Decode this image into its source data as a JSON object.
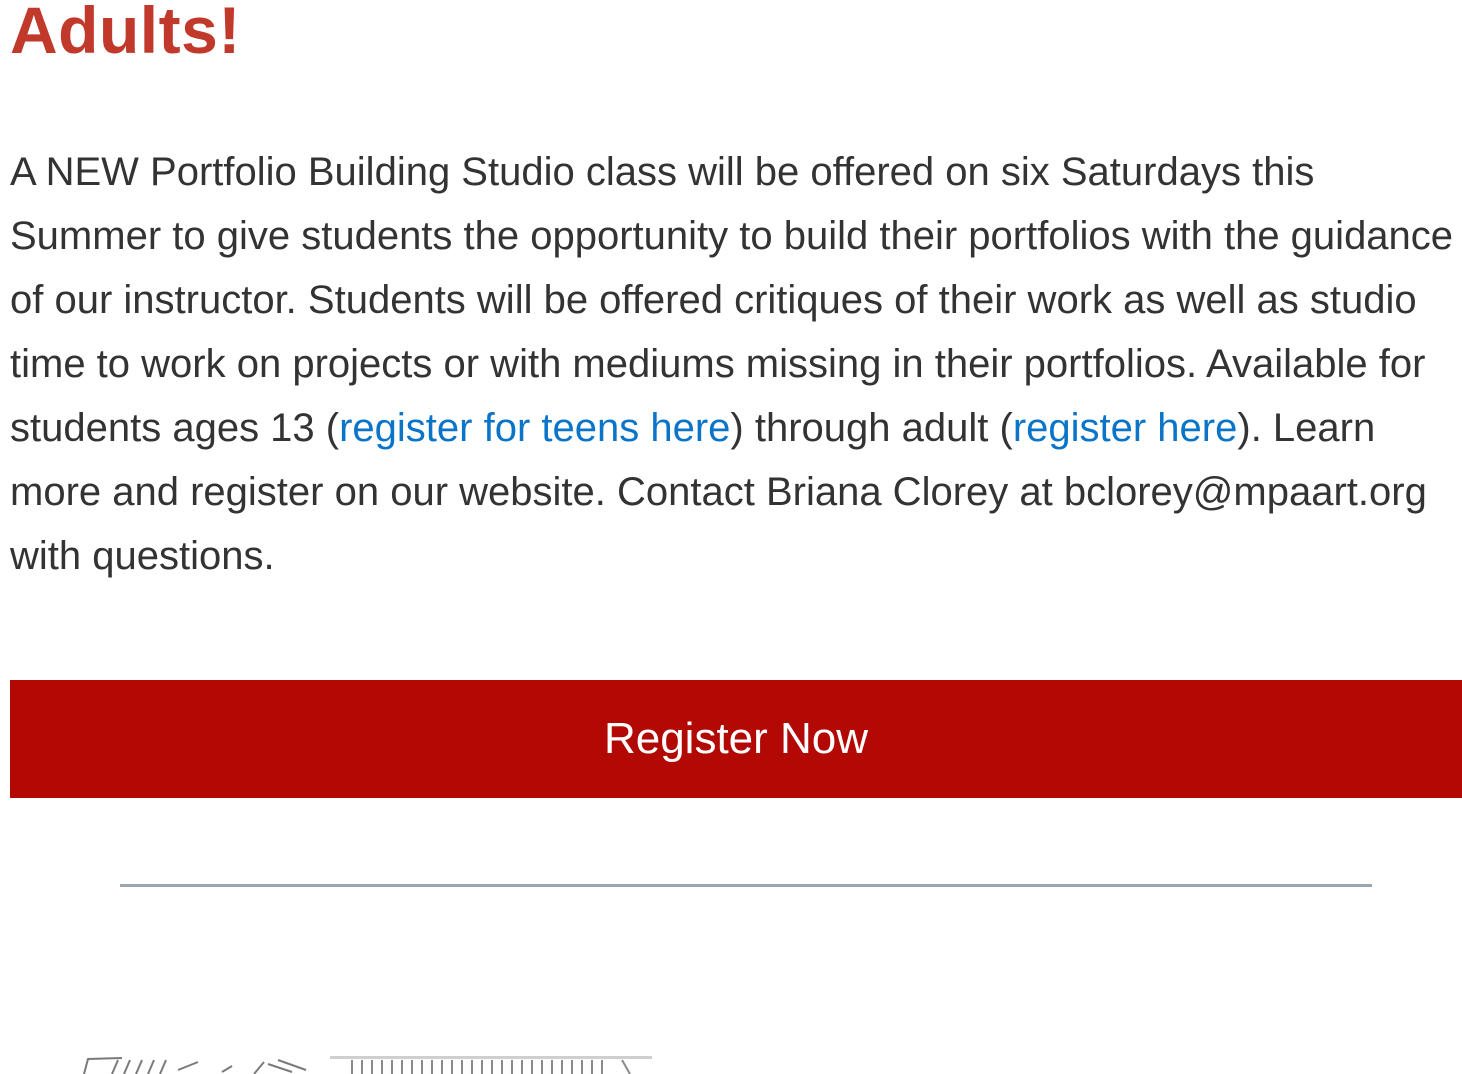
{
  "heading": "Adults!",
  "paragraph": {
    "part1": "A NEW Portfolio Building Studio class will be offered on six Saturdays this Summer to give students the opportunity to build their portfolios with the guidance of our instructor. Students will be offered critiques of their work as well as studio time to work on projects or with mediums missing in their portfolios. Available for students ages 13 (",
    "link_teens": "register for teens here",
    "part2": ") through adult (",
    "link_adult": "register here",
    "part3": "). Learn more and register on our website. Contact Briana Clorey at bclorey@mpaart.org with questions."
  },
  "register_button": "Register Now",
  "colors": {
    "heading": "#c0392b",
    "body_text": "#333333",
    "link": "#0a74c9",
    "button_bg": "#b30904",
    "button_text": "#ffffff",
    "divider": "#9aa8ad"
  }
}
